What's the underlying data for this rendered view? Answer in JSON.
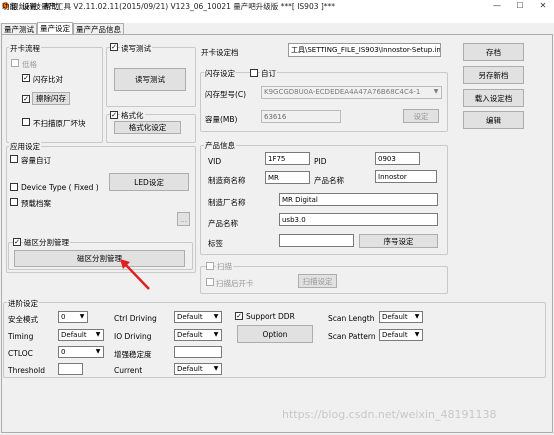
{
  "window": {
    "title": "银灿科技量产工具 V2.11.02.11(2015/09/21)   V123_06_10021 量产吧升级版            ***[ IS903 ]***",
    "minimize": "—",
    "maximize": "☐",
    "close": "✕"
  },
  "menu": [
    "功能",
    "设置",
    "帮助"
  ],
  "tabs": [
    "量产测试",
    "量产设定",
    "量产产品信息"
  ],
  "card_flow": {
    "title": "开卡流程",
    "low_format": "低格",
    "flash_compare": "闪存比对",
    "erase_flash": "擦除闪存",
    "no_scan_bad_block": "不扫描原厂坏块"
  },
  "read_write_test": {
    "label": "读写测试",
    "button": "读写测试"
  },
  "format": {
    "label": "格式化",
    "button": "格式化设定"
  },
  "open_card_file": {
    "label": "开卡设定档",
    "path": "工具\\SETTING_FILE_IS903\\Innostor-Setup.ini"
  },
  "actions": {
    "save": "存档",
    "save_as": "另存新档",
    "load": "载入设定档",
    "edit": "编辑"
  },
  "flash_settings": {
    "title": "闪存设定",
    "custom_label": "自订",
    "model_label": "闪存型号(C)",
    "model_value": "K9GCGD8U0A-ECDEDEA4A47A76B68C4C4-1",
    "capacity_label": "容量(MB)",
    "capacity_value": "63616",
    "set_button": "设定"
  },
  "app_settings": {
    "title": "应用设定",
    "capacity_custom": "容量自订",
    "device_type": "Device Type ( Fixed )",
    "led_button": "LED设定",
    "preload_file": "预载档案",
    "browse_button": "...",
    "partition_label": "磁区分割管理",
    "partition_button": "磁区分割管理"
  },
  "product_info": {
    "title": "产品信息",
    "vid_label": "VID",
    "vid_value": "1F75",
    "pid_label": "PID",
    "pid_value": "0903",
    "vendor_name_label": "制造商名称",
    "vendor_name_value": "MR",
    "product_name_label": "产品名称",
    "product_name_value": "Innostor",
    "manufacturer_label": "制造厂名称",
    "manufacturer_value": "MR Digital",
    "product_label": "产品名称",
    "product_value": "usb3.0",
    "tag_label": "标签",
    "tag_value": "",
    "serial_button": "序号设定"
  },
  "scan": {
    "title": "扫描",
    "after_open_scan": "扫描后开卡",
    "scan_settings_button": "扫描设定"
  },
  "advanced": {
    "title": "进阶设定",
    "safe_mode_label": "安全模式",
    "safe_mode_value": "0",
    "timing_label": "Timing",
    "timing_value": "Default",
    "ctloc_label": "CTLOC",
    "ctloc_value": "0",
    "threshold_label": "Threshold",
    "threshold_value": "",
    "ctrl_driving_label": "Ctrl Driving",
    "ctrl_driving_value": "Default",
    "io_driving_label": "IO Driving",
    "io_driving_value": "Default",
    "enhance_stability_label": "增强稳定度",
    "enhance_stability_value": "",
    "current_label": "Current",
    "current_value": "Default",
    "support_ddr_label": "Support DDR",
    "option_button": "Option",
    "scan_length_label": "Scan Length",
    "scan_length_value": "Default",
    "scan_pattern_label": "Scan Pattern",
    "scan_pattern_value": "Default"
  },
  "watermark": "https://blog.csdn.net/weixin_48191138",
  "colors": {
    "arrow": "#e02020",
    "accent_icon": "#e8731f"
  }
}
